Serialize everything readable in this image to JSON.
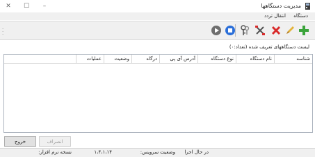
{
  "window": {
    "title": "مدیریت دستگاهها"
  },
  "menu": {
    "items": [
      "دستگاه",
      "انتقال تردد"
    ]
  },
  "toolbar": {
    "buttons": [
      "add-icon",
      "edit-icon",
      "delete-icon",
      "tools-icon",
      "keys-icon",
      "stop-icon",
      "play-icon"
    ],
    "colors": {
      "add": "#3aa43a",
      "edit": "#e3b33a",
      "delete": "#d92b2b",
      "stop": "#2b6fd9",
      "play": "#6e6e6e"
    }
  },
  "list": {
    "caption": "لیست دستگاههای تعریف شده (تعداد:۰)",
    "columns": [
      "شناسه",
      "نام دستگاه",
      "نوع دستگاه",
      "آدرس آی پی",
      "درگاه",
      "وضعیت",
      "عملیات"
    ]
  },
  "buttons": {
    "exit": "خروج",
    "cancel": "انصراف"
  },
  "status": {
    "service_label": "وضعیت سرویس:",
    "service_value": "در حال اجرا",
    "version_label": "نسخه نرم افزار:",
    "version_value": "۱،۴،۱،۱۴"
  }
}
